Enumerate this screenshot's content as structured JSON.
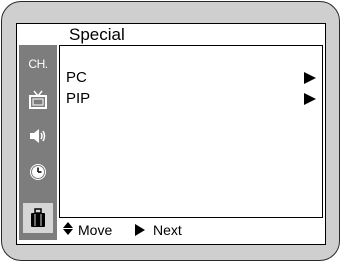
{
  "osd": {
    "title": "Special"
  },
  "sidebar": {
    "items": [
      {
        "label": "CH.",
        "icon": "channel-icon"
      },
      {
        "icon": "tv-icon"
      },
      {
        "icon": "speaker-icon"
      },
      {
        "icon": "clock-icon"
      },
      {
        "icon": "suitcase-icon",
        "active": true
      }
    ]
  },
  "menu": {
    "items": [
      {
        "label": "PC",
        "icon": "arrow-right-icon"
      },
      {
        "label": "PIP",
        "icon": "arrow-right-icon"
      }
    ]
  },
  "footer": {
    "move_label": "Move",
    "next_label": "Next",
    "move_icon": "up-down-arrows-icon",
    "next_icon": "arrow-right-icon"
  },
  "colors": {
    "bezel": "#cfcfcf",
    "sidebar": "#7d7d7d",
    "active_item": "#d6d6d6"
  }
}
